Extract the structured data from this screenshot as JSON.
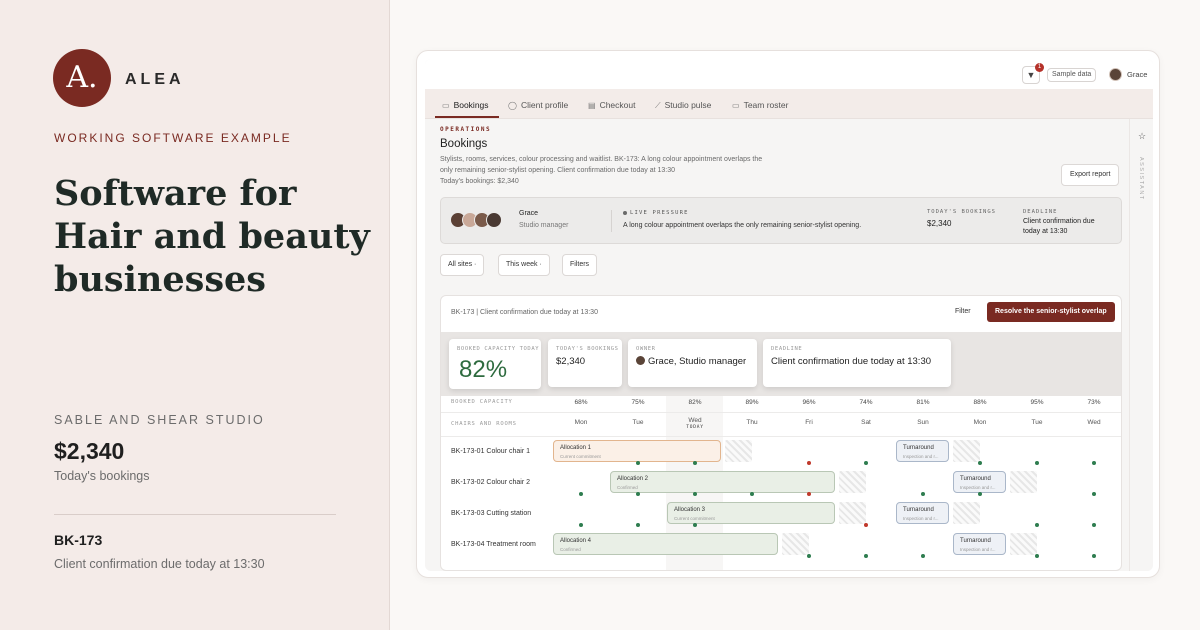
{
  "brand": {
    "logo_letter": "A.",
    "name": "ALEA"
  },
  "eyebrow": "WORKING SOFTWARE EXAMPLE",
  "headline": "Software for Hair and beauty businesses",
  "studio_name": "SABLE AND SHEAR STUDIO",
  "bookings_amount": "$2,340",
  "bookings_label": "Today's bookings",
  "booking": {
    "id": "BK-173",
    "description": "Client confirmation due today at 13:30"
  },
  "app": {
    "topbar": {
      "bell_icon": "bell-icon",
      "notification_count": "1",
      "sample_label": "Sample data",
      "user": "Grace"
    },
    "tabs": [
      {
        "label": "Bookings",
        "icon": "calendar-icon",
        "glyph": "▭"
      },
      {
        "label": "Client profile",
        "icon": "user-icon",
        "glyph": "◯"
      },
      {
        "label": "Checkout",
        "icon": "register-icon",
        "glyph": "▤"
      },
      {
        "label": "Studio pulse",
        "icon": "chart-icon",
        "glyph": "⟋"
      },
      {
        "label": "Team roster",
        "icon": "roster-icon",
        "glyph": "▭"
      }
    ],
    "assistant_label": "ASSISTANT",
    "section": "OPERATIONS",
    "title": "Bookings",
    "description": "Stylists, rooms, services, colour processing and waitlist. BK-173: A long colour appointment overlaps the only remaining senior-stylist opening. Client confirmation due today at 13:30",
    "description_extra": "Today's bookings: $2,340",
    "export_label": "Export report",
    "pressure": {
      "name": "Grace",
      "role": "Studio manager",
      "live_label": "LIVE PRESSURE",
      "live_text": "A long colour appointment overlaps the only remaining senior-stylist opening.",
      "bookings_label": "TODAY'S BOOKINGS",
      "bookings_value": "$2,340",
      "deadline_label": "DEADLINE",
      "deadline_value": "Client confirmation due today at 13:30"
    },
    "filters": {
      "sites": "All sites ·",
      "week": "This week ·",
      "filters": "Filters"
    },
    "card": {
      "header": "BK-173 | Client confirmation due today at 13:30",
      "filter_label": "Filter",
      "resolve_label": "Resolve the senior-stylist overlap"
    },
    "kpis": {
      "capacity_label": "BOOKED CAPACITY TODAY",
      "capacity_value": "82%",
      "bookings_label": "TODAY'S BOOKINGS",
      "bookings_value": "$2,340",
      "owner_label": "OWNER",
      "owner_value": "Grace, Studio manager",
      "deadline_label": "DEADLINE",
      "deadline_value": "Client confirmation due today at 13:30"
    },
    "schedule": {
      "capacity_row_label": "BOOKED CAPACITY",
      "resources_row_label": "CHAIRS AND ROOMS",
      "today_label": "TODAY",
      "capacity": [
        "68%",
        "75%",
        "82%",
        "89%",
        "96%",
        "74%",
        "81%",
        "88%",
        "95%",
        "73%"
      ],
      "days": [
        "Mon",
        "Tue",
        "Wed",
        "Thu",
        "Fri",
        "Sat",
        "Sun",
        "Mon",
        "Tue",
        "Wed"
      ],
      "resources": [
        "BK-173-01 Colour chair 1",
        "BK-173-02 Colour chair 2",
        "BK-173-03 Cutting station",
        "BK-173-04 Treatment room"
      ],
      "allocations": [
        {
          "title": "Allocation 1",
          "sub": "Current commitment"
        },
        {
          "title": "Allocation 2",
          "sub": "Confirmed"
        },
        {
          "title": "Allocation 3",
          "sub": "Current commitment"
        },
        {
          "title": "Allocation 4",
          "sub": "Confirmed"
        }
      ],
      "turnarounds": [
        {
          "title": "Turnaround",
          "sub": "Inspection and r..."
        },
        {
          "title": "Turnaround",
          "sub": "Inspection and r..."
        },
        {
          "title": "Turnaround",
          "sub": "Inspection and r..."
        },
        {
          "title": "Turnaround",
          "sub": "Inspection and r..."
        }
      ]
    }
  },
  "colors": {
    "accent": "#7a2a22",
    "positive": "#2e6b3f",
    "alert": "#c0392b"
  }
}
